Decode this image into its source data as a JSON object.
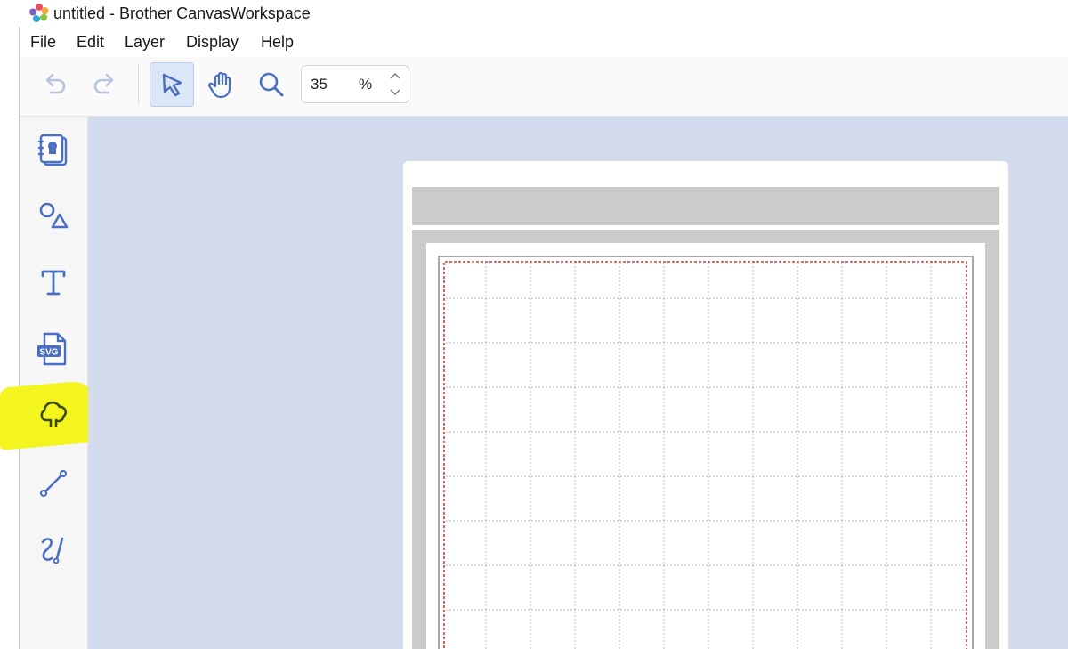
{
  "window": {
    "title": "untitled - Brother CanvasWorkspace",
    "app_icon": "canvasworkspace-logo"
  },
  "menu": {
    "items": [
      "File",
      "Edit",
      "Layer",
      "Display",
      "Help"
    ]
  },
  "toolbar": {
    "undo_icon": "undo-icon",
    "redo_icon": "redo-icon",
    "select_icon": "select-pointer-icon",
    "pan_icon": "hand-pan-icon",
    "zoom_icon": "magnifier-icon",
    "zoom_value": "35",
    "zoom_unit": "%"
  },
  "sidebar": {
    "items": [
      {
        "name": "projects",
        "icon": "project-book-icon"
      },
      {
        "name": "shapes",
        "icon": "shapes-icon"
      },
      {
        "name": "text",
        "icon": "text-icon"
      },
      {
        "name": "svg-import",
        "icon": "svg-file-icon",
        "label": "SVG"
      },
      {
        "name": "patterns",
        "icon": "tree-pattern-icon",
        "highlighted": true
      },
      {
        "name": "line",
        "icon": "line-tool-icon"
      },
      {
        "name": "draw",
        "icon": "freehand-draw-icon"
      }
    ]
  },
  "colors": {
    "accent": "#4a6fc2",
    "workspace_bg": "#d3dcef",
    "mat_gray": "#cbcbcb",
    "cut_boundary": "#d23a3a",
    "highlight": "#f4f51e"
  }
}
